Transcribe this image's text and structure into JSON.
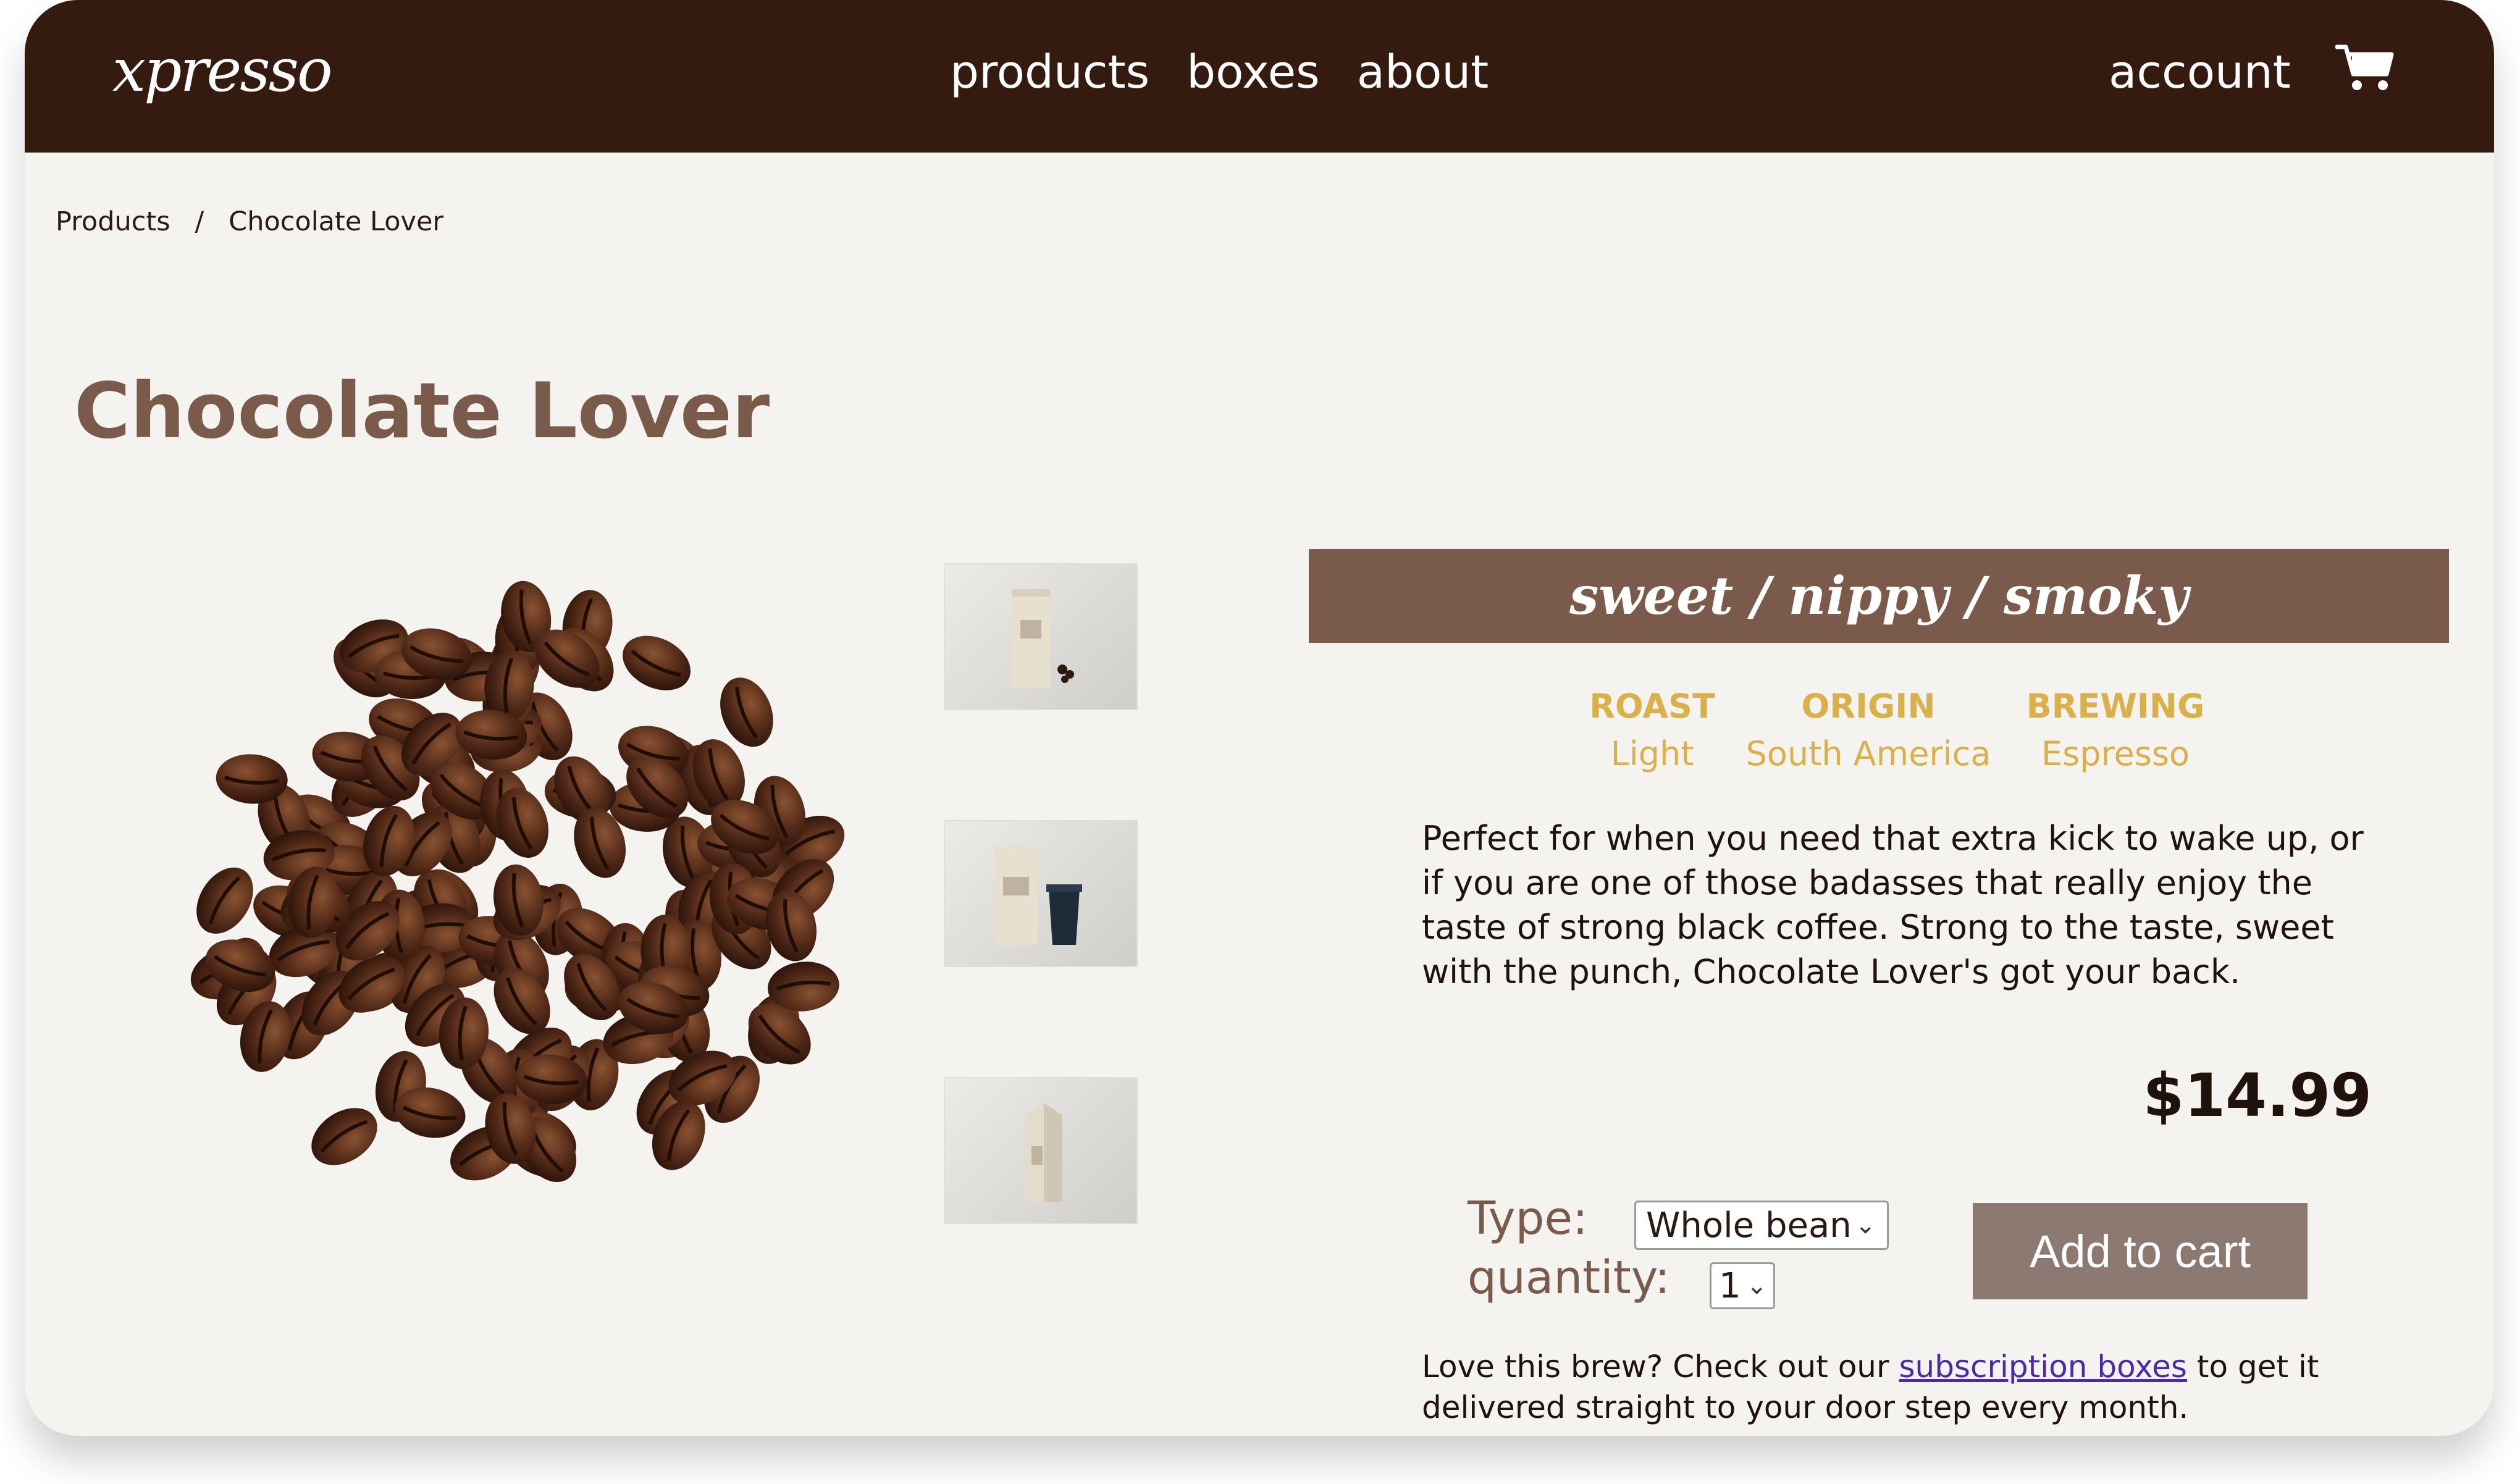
{
  "nav": {
    "logo": "xpresso",
    "links": [
      "products",
      "boxes",
      "about"
    ],
    "account": "account"
  },
  "breadcrumb": {
    "root": "Products",
    "separator": "/",
    "current": "Chocolate Lover"
  },
  "product": {
    "title": "Chocolate Lover",
    "taste_notes": "sweet / nippy / smoky",
    "attributes": [
      {
        "label": "ROAST",
        "value": "Light"
      },
      {
        "label": "ORIGIN",
        "value": "South America"
      },
      {
        "label": "BREWING",
        "value": "Espresso"
      }
    ],
    "description": "Perfect for when you need that extra kick to wake up, or if you are one of those badasses that really enjoy the taste of strong black coffee. Strong to the taste, sweet with the punch, Chocolate Lover's got your back.",
    "price": "$14.99"
  },
  "options": {
    "type_label": "Type:",
    "type_value": "Whole bean",
    "quantity_label": "quantity:",
    "quantity_value": "1",
    "add_to_cart": "Add to cart"
  },
  "subscription": {
    "prefix": "Love this brew? Check out our",
    "link": "subscription boxes",
    "suffix": "to get it delivered straight to your door step every month."
  },
  "colors": {
    "nav_bg": "#351a0f",
    "page_bg": "#f4f3ef",
    "accent": "#7a5a4a",
    "attr_gold": "#d9b04a",
    "button_bg": "#8c7a72"
  },
  "icons": [
    "cart-icon",
    "chevron-down-icon"
  ]
}
